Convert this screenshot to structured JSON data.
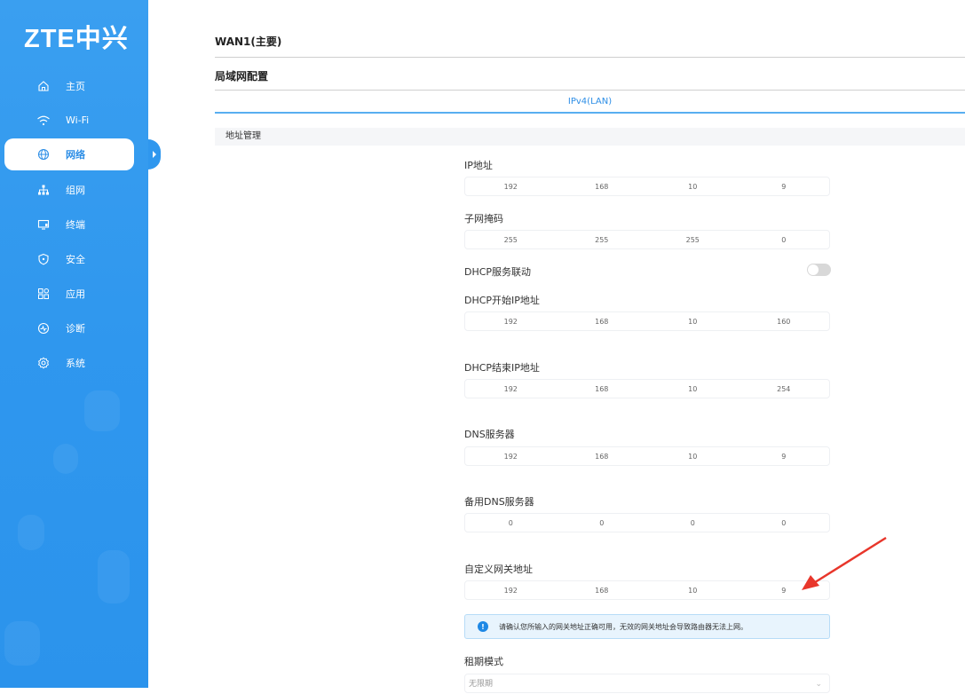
{
  "brand": {
    "logo_text": "ZTE中兴"
  },
  "sidebar": {
    "items": [
      {
        "label": "主页",
        "icon": "home-icon"
      },
      {
        "label": "Wi-Fi",
        "icon": "wifi-icon"
      },
      {
        "label": "网络",
        "icon": "globe-icon",
        "active": true
      },
      {
        "label": "组网",
        "icon": "mesh-icon"
      },
      {
        "label": "终端",
        "icon": "monitor-icon"
      },
      {
        "label": "安全",
        "icon": "shield-icon"
      },
      {
        "label": "应用",
        "icon": "apps-icon"
      },
      {
        "label": "诊断",
        "icon": "diagnose-icon"
      },
      {
        "label": "系统",
        "icon": "gear-icon"
      }
    ]
  },
  "header": {
    "wan_title": "WAN1(主要)",
    "lan_title": "局域网配置"
  },
  "tabs": {
    "active": "IPv4(LAN)"
  },
  "section": {
    "title": "地址管理"
  },
  "form": {
    "ip": {
      "label": "IP地址",
      "octets": [
        "192",
        "168",
        "10",
        "9"
      ]
    },
    "mask": {
      "label": "子网掩码",
      "octets": [
        "255",
        "255",
        "255",
        "0"
      ]
    },
    "dhcp": {
      "label": "DHCP服务联动",
      "enabled": false
    },
    "dhcp_start": {
      "label": "DHCP开始IP地址",
      "octets": [
        "192",
        "168",
        "10",
        "160"
      ]
    },
    "dhcp_end": {
      "label": "DHCP结束IP地址",
      "octets": [
        "192",
        "168",
        "10",
        "254"
      ]
    },
    "dns": {
      "label": "DNS服务器",
      "octets": [
        "192",
        "168",
        "10",
        "9"
      ]
    },
    "dns_backup": {
      "label": "备用DNS服务器",
      "octets": [
        "0",
        "0",
        "0",
        "0"
      ]
    },
    "gateway": {
      "label": "自定义网关地址",
      "octets": [
        "192",
        "168",
        "10",
        "9"
      ]
    },
    "notice": "请确认您所输入的网关地址正确可用，无效的网关地址会导致路由器无法上网。",
    "lease": {
      "label": "租期模式",
      "value": "无限期"
    }
  },
  "colors": {
    "sidebar": "#2f97ee",
    "accent": "#2d8ee6",
    "arrow": "#e8362b"
  }
}
